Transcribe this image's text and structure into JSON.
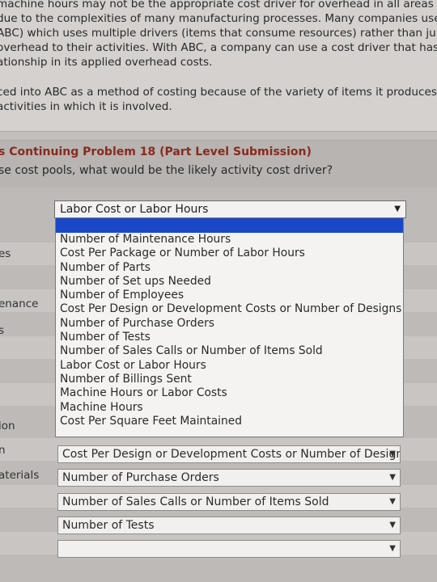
{
  "intro": {
    "paragraph1": [
      "machine hours may not be the appropriate cost driver for overhead in all areas",
      "due to the complexities of many manufacturing processes. Many companies use",
      "ABC) which uses multiple drivers (items that consume resources) rather than ju",
      "overhead to their activities. With ABC, a company can use a cost driver that has",
      "ationship in its applied overhead costs."
    ],
    "paragraph2": [
      "ced into ABC as a method of costing because of the variety of items it produces",
      "activities in which it is involved."
    ]
  },
  "problem": {
    "heading": "s Continuing Problem 18 (Part Level Submission)",
    "question": "se cost pools, what would be the likely activity cost driver?"
  },
  "row_labels": [
    "es",
    "enance",
    "s",
    "ion",
    "n",
    "aterials"
  ],
  "open_dropdown": {
    "selected": "Labor Cost or Labor Hours",
    "options": [
      "Number of Maintenance Hours",
      "Cost Per Package or Number of Labor Hours",
      "Number of Parts",
      "Number of Set ups Needed",
      "Number of Employees",
      "Cost Per Design or Development Costs or Number of Designs",
      "Number of Purchase Orders",
      "Number of Tests",
      "Number of Sales Calls or Number of Items Sold",
      "Labor Cost or Labor Hours",
      "Number of Billings Sent",
      "Machine Hours or Labor Costs",
      "Machine Hours",
      "Cost Per Square Feet Maintained"
    ]
  },
  "selects": [
    "Cost Per Design or Development Costs or Number of Designs",
    "Number of Purchase Orders",
    "Number of Sales Calls or Number of Items Sold",
    "Number of Tests",
    ""
  ],
  "arrow_glyph": "▼",
  "colors": {
    "heading": "#8a2a1e",
    "highlight": "#1a48c6"
  }
}
